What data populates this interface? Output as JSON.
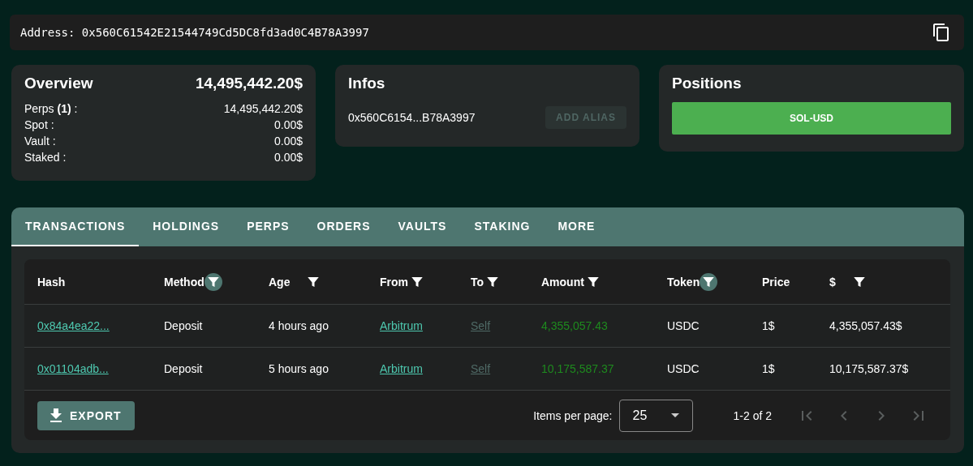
{
  "address": {
    "label": "Address:",
    "value": "0x560C61542E21544749Cd5DC8fd3ad0C4B78A3997"
  },
  "overview": {
    "title": "Overview",
    "total": "14,495,442.20$",
    "lines": [
      {
        "label": "Perps **(1)** :",
        "value": "14,495,442.20$"
      },
      {
        "label": "Spot :",
        "value": "0.00$"
      },
      {
        "label": "Vault :",
        "value": "0.00$"
      },
      {
        "label": "Staked :",
        "value": "0.00$"
      }
    ]
  },
  "infos": {
    "title": "Infos",
    "address_short": "0x560C6154...B78A3997",
    "alias_button": {
      "label": "ADD ALIAS",
      "disabled": true
    }
  },
  "positions": {
    "title": "Positions",
    "items": [
      "SOL-USD"
    ]
  },
  "tabs": [
    {
      "label": "TRANSACTIONS",
      "selected": true
    },
    {
      "label": "HOLDINGS",
      "selected": false
    },
    {
      "label": "PERPS",
      "selected": false
    },
    {
      "label": "ORDERS",
      "selected": false
    },
    {
      "label": "VAULTS",
      "selected": false
    },
    {
      "label": "STAKING",
      "selected": false
    },
    {
      "label": "MORE",
      "selected": false
    }
  ],
  "table": {
    "columns": [
      {
        "label": "Hash",
        "filterable": false
      },
      {
        "label": "Method",
        "filterable": true,
        "filter_active": true
      },
      {
        "label": "Age",
        "filterable": true,
        "filter_active": false
      },
      {
        "label": "From",
        "filterable": true,
        "filter_active": false
      },
      {
        "label": "To",
        "filterable": true,
        "filter_active": false
      },
      {
        "label": "Amount",
        "filterable": true,
        "filter_active": false
      },
      {
        "label": "Token",
        "filterable": true,
        "filter_active": true
      },
      {
        "label": "Price",
        "filterable": false
      },
      {
        "label": "$",
        "filterable": true,
        "filter_active": false
      }
    ],
    "rows": [
      [
        {
          "text": "0x84a4ea22...",
          "kind": "link"
        },
        {
          "text": "Deposit",
          "kind": "text"
        },
        {
          "text": "4 hours ago",
          "kind": "text"
        },
        {
          "text": "Arbitrum",
          "kind": "link"
        },
        {
          "text": "Self",
          "kind": "muted-link"
        },
        {
          "text": "4,355,057.43",
          "kind": "amount"
        },
        {
          "text": "USDC",
          "kind": "text"
        },
        {
          "text": "1$",
          "kind": "text"
        },
        {
          "text": "4,355,057.43$",
          "kind": "text"
        }
      ],
      [
        {
          "text": "0x01104adb...",
          "kind": "link"
        },
        {
          "text": "Deposit",
          "kind": "text"
        },
        {
          "text": "5 hours ago",
          "kind": "text"
        },
        {
          "text": "Arbitrum",
          "kind": "link"
        },
        {
          "text": "Self",
          "kind": "muted-link"
        },
        {
          "text": "10,175,587.37",
          "kind": "amount"
        },
        {
          "text": "USDC",
          "kind": "text"
        },
        {
          "text": "1$",
          "kind": "text"
        },
        {
          "text": "10,175,587.37$",
          "kind": "text"
        }
      ]
    ],
    "export_button": "EXPORT",
    "pagination": {
      "items_label": "Items per page:",
      "page_size": "25",
      "range": "1-2 of 2",
      "buttons": [
        {
          "kind": "first",
          "disabled": true
        },
        {
          "kind": "prev",
          "disabled": true
        },
        {
          "kind": "next",
          "disabled": true
        },
        {
          "kind": "last",
          "disabled": true
        }
      ]
    }
  }
}
